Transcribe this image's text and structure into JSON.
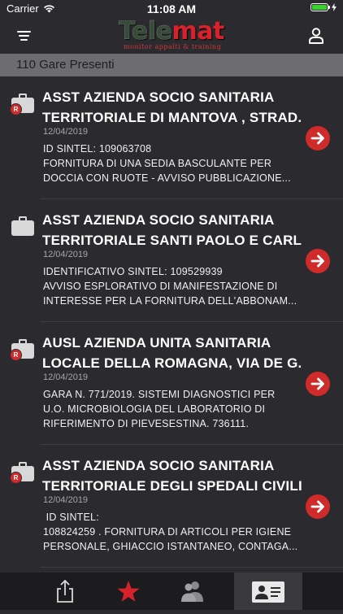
{
  "status_bar": {
    "carrier": "Carrier",
    "time": "11:08 AM",
    "battery_level": 1.0,
    "battery_color": "#3ad12f"
  },
  "nav": {
    "logo_part1": "Tele",
    "logo_part2": "mat",
    "logo_subtitle": "monitor appalti & training",
    "menu_icon": "hamburger-menu-icon",
    "user_icon": "user-icon"
  },
  "count_header": "110 Gare Presenti",
  "accent_color": "#cf2b2a",
  "items": [
    {
      "title_line1": "ASST AZIENDA SOCIO SANITARIA",
      "title_line2": "TERRITORIALE DI MANTOVA , STRAD...",
      "date": "12/04/2019",
      "desc_line1": "ID SINTEL: 109063708",
      "desc_line2": "FORNITURA DI UNA SEDIA BASCULANTE PER",
      "desc_line3": "DOCCIA CON RUOTE - AVVISO PUBBLICAZIONE...",
      "badge": "R"
    },
    {
      "title_line1": "ASST AZIENDA SOCIO SANITARIA",
      "title_line2": "TERRITORIALE SANTI PAOLO E CARL...",
      "date": "12/04/2019",
      "desc_line1": "IDENTIFICATIVO SINTEL: 109529939",
      "desc_line2": "AVVISO ESPLORATIVO DI MANIFESTAZIONE DI",
      "desc_line3": "INTERESSE PER LA FORNITURA DELL'ABBONAM...",
      "badge": ""
    },
    {
      "title_line1": "AUSL AZIENDA UNITA SANITARIA",
      "title_line2": "LOCALE DELLA ROMAGNA, VIA DE G...",
      "date": "12/04/2019",
      "desc_line1": "GARA N. 771/2019. SISTEMI DIAGNOSTICI PER",
      "desc_line2": "U.O. MICROBIOLOGIA DEL LABORATORIO DI",
      "desc_line3": "RIFERIMENTO DI PIEVESESTINA. 736111.",
      "badge": "R"
    },
    {
      "title_line1": "ASST AZIENDA SOCIO SANITARIA",
      "title_line2": "TERRITORIALE DEGLI SPEDALI CIVILI...",
      "date": "12/04/2019",
      "desc_line1": " ID SINTEL:",
      "desc_line2": "108824259 . FORNITURA DI ARTICOLI PER IGIENE",
      "desc_line3": "PERSONALE, GHIACCIO ISTANTANEO, CONTAGA...",
      "badge": "R"
    }
  ],
  "tabbar": {
    "tabs": [
      "share-icon",
      "star-icon",
      "group-icon",
      "contact-card-icon"
    ],
    "active_tab": "contact-card-icon"
  }
}
